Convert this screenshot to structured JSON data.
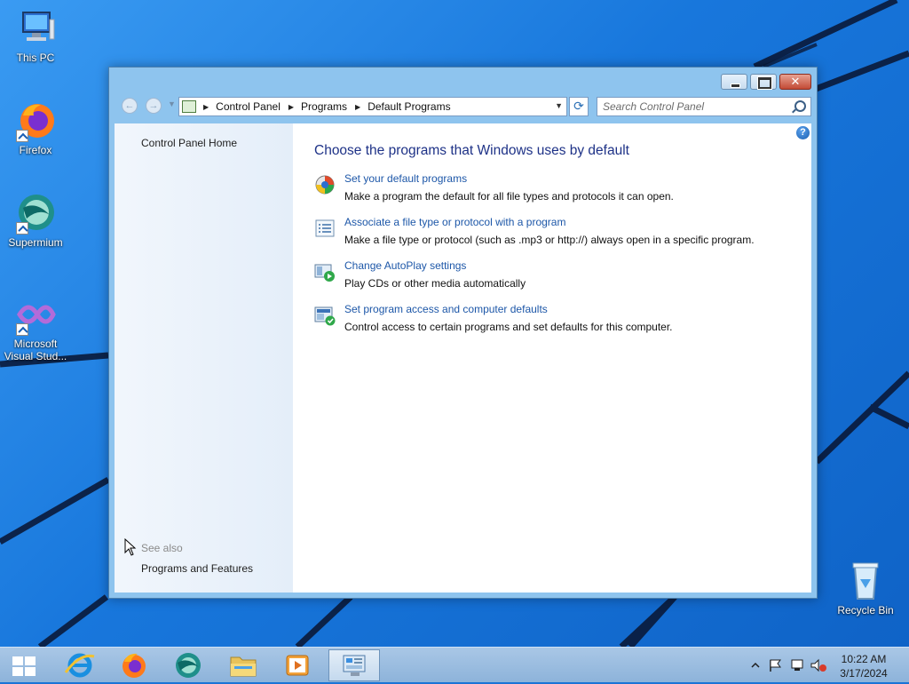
{
  "desktop": {
    "icons": [
      {
        "label": "This PC"
      },
      {
        "label": "Firefox"
      },
      {
        "label": "Supermium"
      },
      {
        "label": "Microsoft Visual Stud..."
      },
      {
        "label": "Recycle Bin"
      }
    ]
  },
  "window": {
    "breadcrumb": [
      "Control Panel",
      "Programs",
      "Default Programs"
    ],
    "search_placeholder": "Search Control Panel",
    "sidebar": {
      "home_link": "Control Panel Home",
      "see_also_heading": "See also",
      "see_also_links": [
        "Programs and Features"
      ]
    },
    "main": {
      "title": "Choose the programs that Windows uses by default",
      "tasks": [
        {
          "link": "Set your default programs",
          "description": "Make a program the default for all file types and protocols it can open.",
          "icon": "default-programs-icon"
        },
        {
          "link": "Associate a file type or protocol with a program",
          "description": "Make a file type or protocol (such as .mp3 or http://) always open in a specific program.",
          "icon": "file-association-icon"
        },
        {
          "link": "Change AutoPlay settings",
          "description": "Play CDs or other media automatically",
          "icon": "autoplay-icon"
        },
        {
          "link": "Set program access and computer defaults",
          "description": "Control access to certain programs and set defaults for this computer.",
          "icon": "program-access-icon"
        }
      ]
    }
  },
  "taskbar": {
    "clock_time": "10:22 AM",
    "clock_date": "3/17/2024"
  },
  "colors": {
    "link": "#1d57a8",
    "title": "#1e3287",
    "desktop": "#1877dc"
  }
}
